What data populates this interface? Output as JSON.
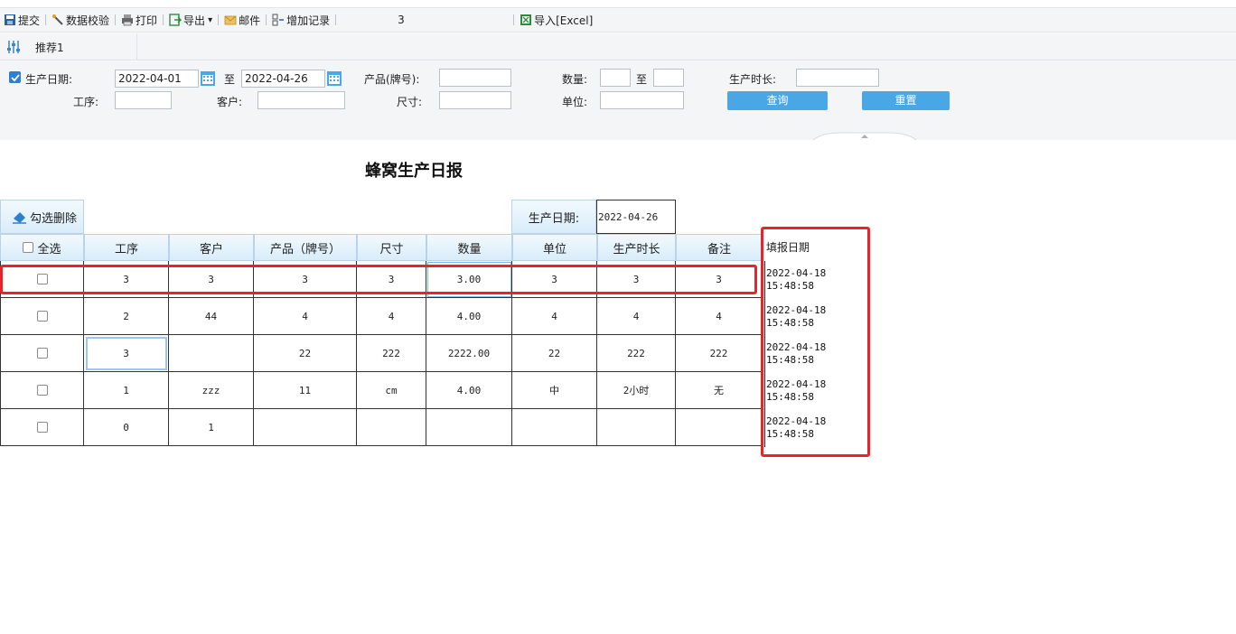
{
  "toolbar": {
    "submit": "提交",
    "validate": "数据校验",
    "print": "打印",
    "export": "导出",
    "export_caret": "▾",
    "mail": "邮件",
    "add_record": "增加记录",
    "page_number": "3",
    "import_excel": "导入[Excel]"
  },
  "tabs": {
    "recommend": "推荐1"
  },
  "filter": {
    "prod_date_label": "生产日期:",
    "date_from": "2022-04-01",
    "to1": "至",
    "date_to": "2022-04-26",
    "product_label": "产品(牌号):",
    "qty_label": "数量:",
    "to2": "至",
    "duration_label": "生产时长:",
    "process_label": "工序:",
    "customer_label": "客户:",
    "size_label": "尺寸:",
    "unit_label": "单位:",
    "query_button": "查询",
    "reset_button": "重置"
  },
  "report": {
    "title": "蜂窝生产日报",
    "delete_selected": "勾选删除",
    "prod_date_label": "生产日期:",
    "prod_date_value": "2022-04-26",
    "select_all": "全选",
    "columns": [
      "工序",
      "客户",
      "产品（牌号）",
      "尺寸",
      "数量",
      "单位",
      "生产时长",
      "备注"
    ],
    "rows": [
      [
        "3",
        "3",
        "3",
        "3",
        "3.00",
        "3",
        "3",
        "3"
      ],
      [
        "2",
        "44",
        "4",
        "4",
        "4.00",
        "4",
        "4",
        "4"
      ],
      [
        "3",
        "",
        "22",
        "222",
        "2222.00",
        "22",
        "222",
        "222"
      ],
      [
        "1",
        "zzz",
        "11",
        "cm",
        "4.00",
        "中",
        "2小时",
        "无"
      ],
      [
        "0",
        "1",
        "",
        "",
        "",
        "",
        "",
        ""
      ]
    ],
    "side_header": "填报日期",
    "side_dates": [
      [
        "2022-04-18",
        "15:48:58"
      ],
      [
        "2022-04-18",
        "15:48:58"
      ],
      [
        "2022-04-18",
        "15:48:58"
      ],
      [
        "2022-04-18",
        "15:48:58"
      ],
      [
        "2022-04-18",
        "15:48:58"
      ]
    ]
  },
  "colors": {
    "accent": "#4aa7e6",
    "highlight": "#e8242a",
    "header_bg": "#d9ecfa"
  }
}
